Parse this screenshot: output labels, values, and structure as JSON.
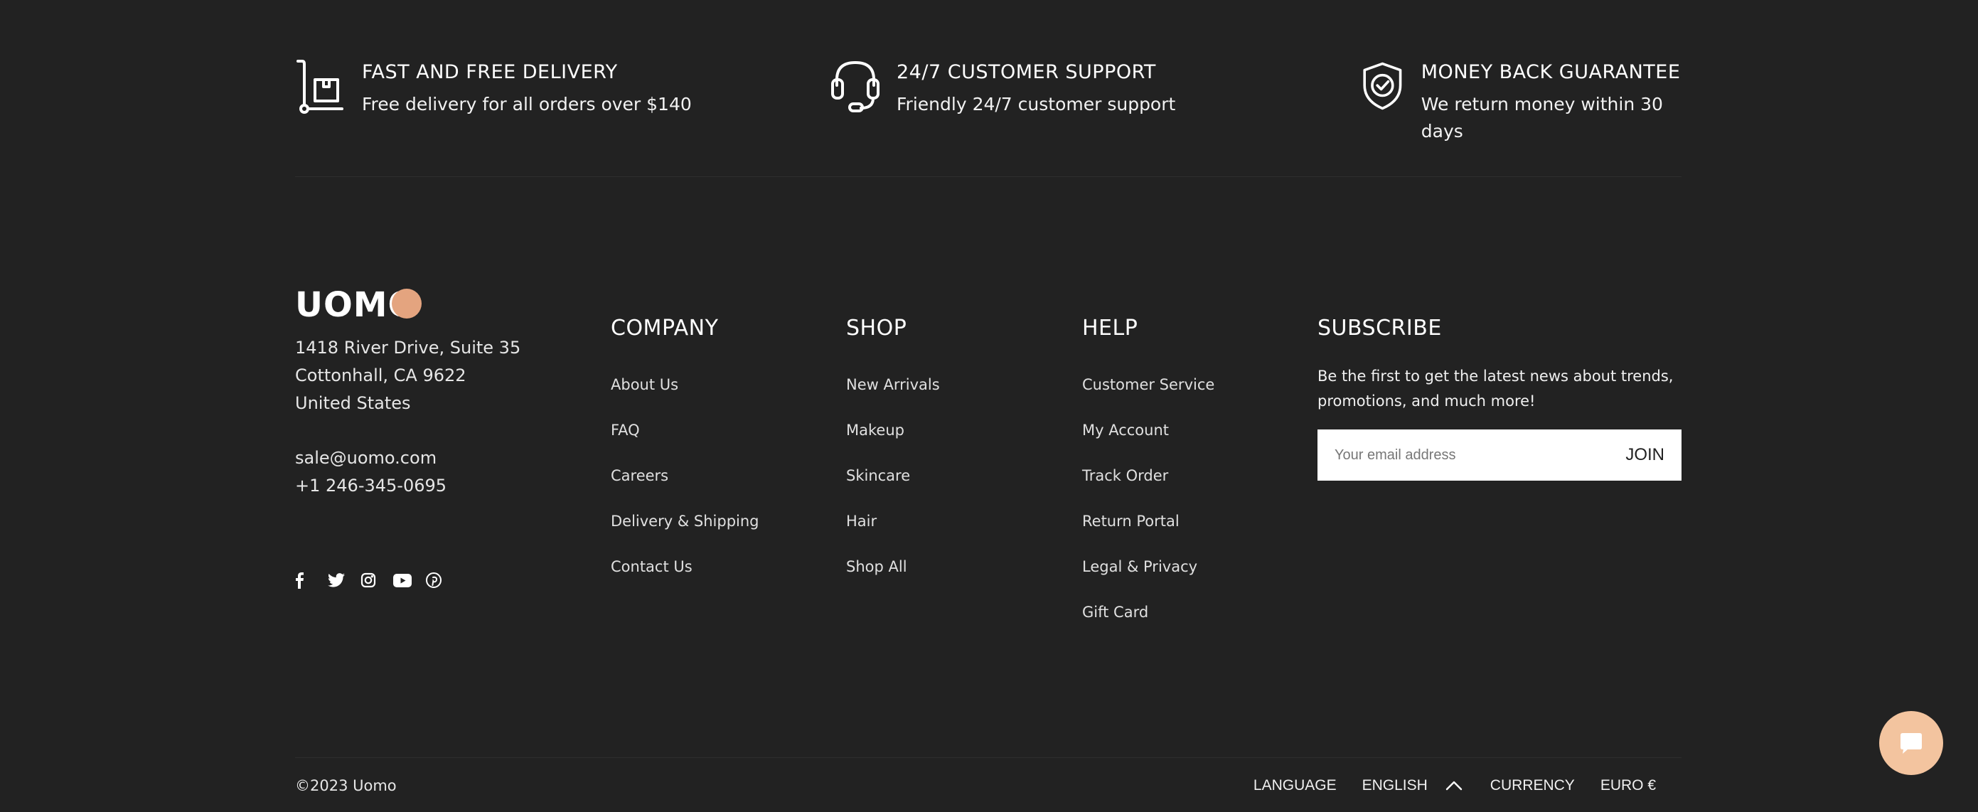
{
  "features": [
    {
      "icon": "delivery-cart-icon",
      "title": "FAST AND FREE DELIVERY",
      "desc": "Free delivery for all orders over $140"
    },
    {
      "icon": "headset-support-icon",
      "title": "24/7 CUSTOMER SUPPORT",
      "desc": "Friendly 24/7 customer support"
    },
    {
      "icon": "shield-check-icon",
      "title": "MONEY BACK GUARANTEE",
      "desc": "We return money within 30 days"
    }
  ],
  "brand": {
    "logo_text": "UOMO",
    "logo_accent": "#E4A47F",
    "address_line1": "1418 River Drive, Suite 35",
    "address_line2": "Cottonhall, CA 9622",
    "address_line3": "United States",
    "email": "sale@uomo.com",
    "phone": "+1 246-345-0695",
    "social": [
      "facebook-icon",
      "twitter-icon",
      "instagram-icon",
      "youtube-icon",
      "pinterest-icon"
    ]
  },
  "columns": [
    {
      "title": "COMPANY",
      "items": [
        "About Us",
        "FAQ",
        "Careers",
        "Delivery & Shipping",
        "Contact Us"
      ]
    },
    {
      "title": "SHOP",
      "items": [
        "New Arrivals",
        "Makeup",
        "Skincare",
        "Hair",
        "Shop All"
      ]
    },
    {
      "title": "HELP",
      "items": [
        "Customer Service",
        "My Account",
        "Track Order",
        "Return Portal",
        "Legal & Privacy",
        "Gift Card"
      ]
    }
  ],
  "subscribe": {
    "title": "SUBSCRIBE",
    "text": "Be the first to get the latest news about trends, promotions, and much more!",
    "placeholder": "Your email address",
    "button": "JOIN"
  },
  "bottom": {
    "copyright": "©2023 Uomo",
    "language_label": "LANGUAGE",
    "language_value": "ENGLISH",
    "currency_label": "CURRENCY",
    "currency_value": "EURO €"
  },
  "colors": {
    "background": "#222222",
    "chat_button": "#F3C49F"
  },
  "chat": {
    "icon": "chat-bubble-icon"
  }
}
